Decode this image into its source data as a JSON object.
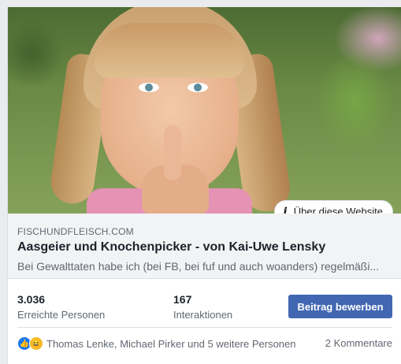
{
  "link_preview": {
    "image_alt": "Mädchen mit Finger vor dem Mund",
    "about_site_label": "Über diese Website",
    "domain": "FISCHUNDFLEISCH.COM",
    "headline": "Aasgeier und Knochenpicker - von Kai-Uwe Lensky",
    "description": "Bei Gewalttaten habe ich (bei FB, bei fuf und auch woanders) regelmäßi..."
  },
  "stats": {
    "reach_value": "3.036",
    "reach_label": "Erreichte Personen",
    "engagement_value": "167",
    "engagement_label": "Interaktionen",
    "boost_label": "Beitrag bewerben"
  },
  "reactions": {
    "icons": [
      "like-icon",
      "haha-icon"
    ],
    "text": "Thomas Lenke, Michael Pirker und 5 weitere Personen",
    "comments": "2 Kommentare"
  },
  "colors": {
    "accent": "#4267b2",
    "like": "#1877f2",
    "haha": "#f7b928"
  }
}
